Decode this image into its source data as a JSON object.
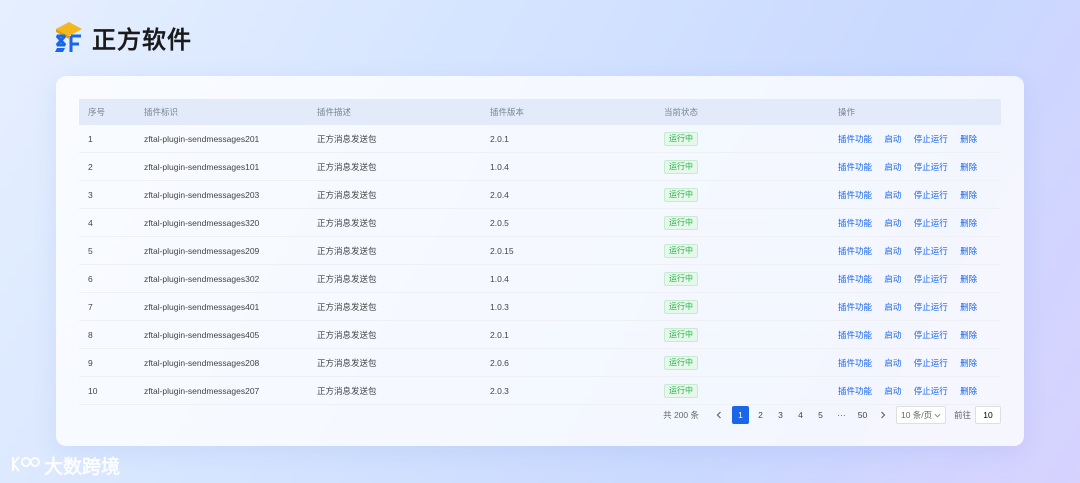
{
  "brand": {
    "name": "正方软件"
  },
  "table": {
    "headers": [
      "序号",
      "插件标识",
      "插件描述",
      "插件版本",
      "当前状态",
      "操作"
    ],
    "rows": [
      {
        "no": "1",
        "id": "zftal-plugin-sendmessages201",
        "desc": "正方消息发送包",
        "version": "2.0.1",
        "status": "运行中"
      },
      {
        "no": "2",
        "id": "zftal-plugin-sendmessages101",
        "desc": "正方消息发送包",
        "version": "1.0.4",
        "status": "运行中"
      },
      {
        "no": "3",
        "id": "zftal-plugin-sendmessages203",
        "desc": "正方消息发送包",
        "version": "2.0.4",
        "status": "运行中"
      },
      {
        "no": "4",
        "id": "zftal-plugin-sendmessages320",
        "desc": "正方消息发送包",
        "version": "2.0.5",
        "status": "运行中"
      },
      {
        "no": "5",
        "id": "zftal-plugin-sendmessages209",
        "desc": "正方消息发送包",
        "version": "2.0.15",
        "status": "运行中"
      },
      {
        "no": "6",
        "id": "zftal-plugin-sendmessages302",
        "desc": "正方消息发送包",
        "version": "1.0.4",
        "status": "运行中"
      },
      {
        "no": "7",
        "id": "zftal-plugin-sendmessages401",
        "desc": "正方消息发送包",
        "version": "1.0.3",
        "status": "运行中"
      },
      {
        "no": "8",
        "id": "zftal-plugin-sendmessages405",
        "desc": "正方消息发送包",
        "version": "2.0.1",
        "status": "运行中"
      },
      {
        "no": "9",
        "id": "zftal-plugin-sendmessages208",
        "desc": "正方消息发送包",
        "version": "2.0.6",
        "status": "运行中"
      },
      {
        "no": "10",
        "id": "zftal-plugin-sendmessages207",
        "desc": "正方消息发送包",
        "version": "2.0.3",
        "status": "运行中"
      }
    ],
    "actions": [
      "插件功能",
      "启动",
      "停止运行",
      "删除"
    ]
  },
  "pagination": {
    "total": "共 200 条",
    "pages": [
      "1",
      "2",
      "3",
      "4",
      "5"
    ],
    "ellipsis": "···",
    "last": "50",
    "current": "1",
    "page_size": "10 条/页",
    "goto_label": "前往",
    "goto_value": "10",
    "prev_icon": "chevron-left-icon",
    "next_icon": "chevron-right-icon"
  },
  "watermark": {
    "text": "大数跨境"
  },
  "colors": {
    "accent": "#1a66e8",
    "status_green": "#27b04b",
    "header_bg": "#e3ebfa"
  }
}
